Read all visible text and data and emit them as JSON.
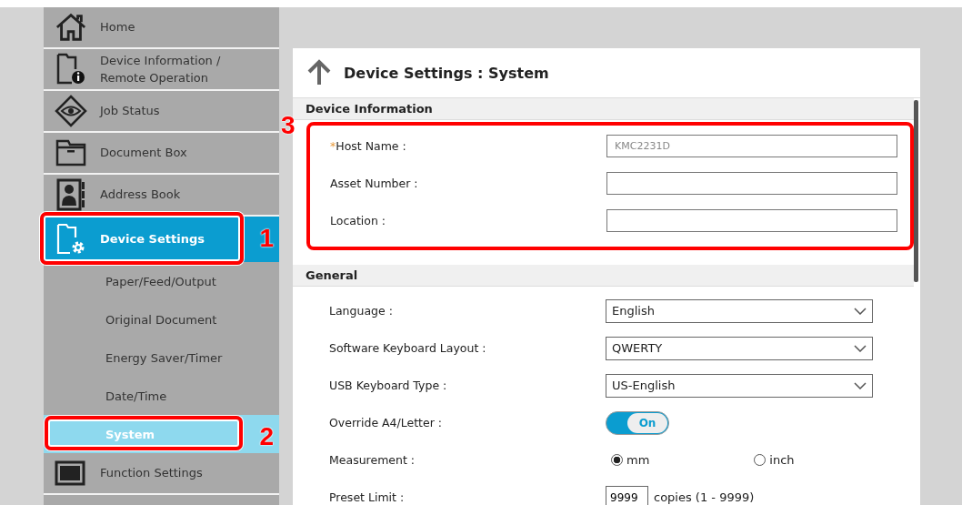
{
  "sidebar": {
    "items": [
      {
        "label": "Home",
        "selected": false
      },
      {
        "label": "Device Information /\nRemote Operation",
        "selected": false
      },
      {
        "label": "Job Status",
        "selected": false
      },
      {
        "label": "Document Box",
        "selected": false
      },
      {
        "label": "Address Book",
        "selected": false
      },
      {
        "label": "Device Settings",
        "selected": true,
        "callout": "1",
        "children": [
          {
            "label": "Paper/Feed/Output",
            "selected": false
          },
          {
            "label": "Original Document",
            "selected": false
          },
          {
            "label": "Energy Saver/Timer",
            "selected": false
          },
          {
            "label": "Date/Time",
            "selected": false
          },
          {
            "label": "System",
            "selected": true,
            "callout": "2"
          }
        ]
      },
      {
        "label": "Function Settings",
        "selected": false
      }
    ]
  },
  "page": {
    "title": "Device Settings : System",
    "sections": [
      {
        "title": "Device Information",
        "callout": "3",
        "fields": [
          {
            "kind": "text",
            "label": "Host Name :",
            "required_mark": "*",
            "value": "KMC2231D"
          },
          {
            "kind": "text",
            "label": "Asset Number :"
          },
          {
            "kind": "text",
            "label": "Location :"
          }
        ]
      },
      {
        "title": "General",
        "fields": [
          {
            "kind": "select",
            "label": "Language :",
            "value": "English"
          },
          {
            "kind": "select",
            "label": "Software Keyboard Layout :",
            "value": "QWERTY"
          },
          {
            "kind": "select",
            "label": "USB Keyboard Type :",
            "value": "US-English"
          },
          {
            "kind": "toggle",
            "label": "Override A4/Letter :",
            "on": true,
            "text": "On"
          },
          {
            "kind": "radio",
            "label": "Measurement :",
            "options": [
              {
                "label": "mm",
                "selected": true
              },
              {
                "label": "inch",
                "selected": false
              }
            ]
          },
          {
            "kind": "number",
            "label": "Preset Limit :",
            "value": "9999",
            "suffix": "copies (1 - 9999)"
          }
        ]
      }
    ]
  }
}
